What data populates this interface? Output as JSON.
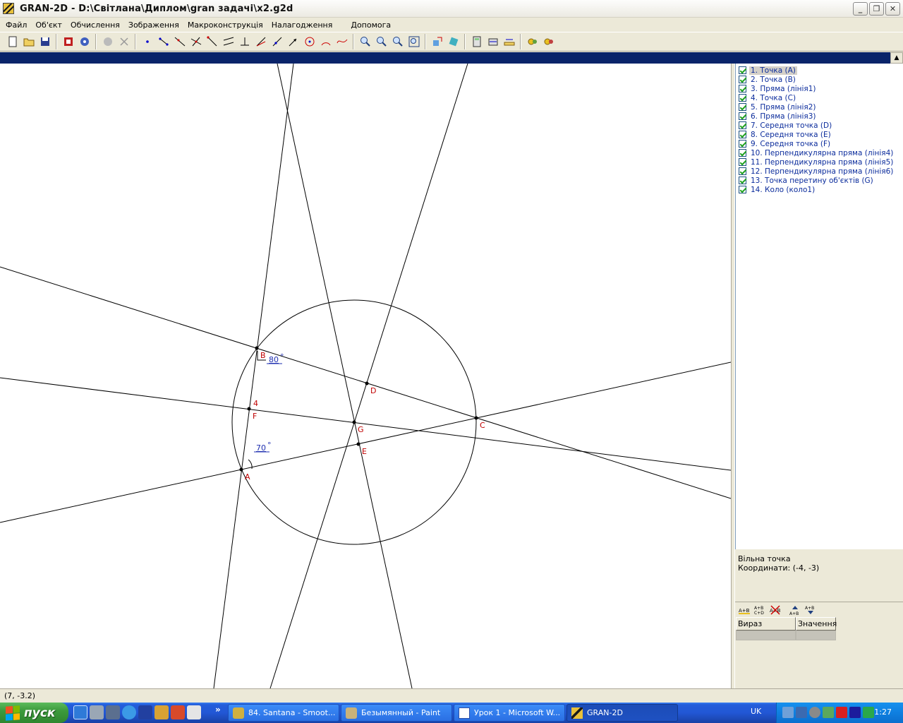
{
  "window": {
    "title": "GRAN-2D - D:\\Світлана\\Диплом\\gran задачі\\x2.g2d",
    "minimize_label": "_",
    "maximize_label": "❐",
    "close_label": "✕"
  },
  "menu": {
    "items": [
      "Файл",
      "Об'єкт",
      "Обчислення",
      "Зображення",
      "Макроконструкція",
      "Налагодження",
      "Допомога"
    ]
  },
  "toolbar": {
    "buttons": [
      "new-file-icon",
      "open-folder-icon",
      "save-disk-icon",
      "sep",
      "film-icon",
      "settings-icon",
      "sep",
      "disabled-icon",
      "cut-icon",
      "sep",
      "point-icon",
      "segment-icon",
      "line-icon",
      "intersect-icon",
      "ray-icon",
      "parallel-icon",
      "perpendicular-icon",
      "bisector-icon",
      "tangent-icon",
      "vector-icon",
      "circle-icon",
      "arc-icon",
      "curve-icon",
      "sep",
      "zoom-in-icon",
      "zoom-out-icon",
      "zoom-fit-icon",
      "zoom-window-icon",
      "sep",
      "move-icon",
      "rotate-icon",
      "sep",
      "calculator-icon",
      "measure-icon",
      "ruler-icon",
      "sep",
      "macro-icon",
      "macro-run-icon"
    ]
  },
  "canvas": {
    "labels": {
      "A": "A",
      "B": "B",
      "C": "C",
      "D": "D",
      "E": "E",
      "F": "F",
      "G": "G",
      "side_label": "4",
      "angle_B": "80",
      "angle_A": "70",
      "degree": "°"
    }
  },
  "objects": [
    {
      "label": "1. Точка (A)",
      "selected": true
    },
    {
      "label": "2. Точка (B)"
    },
    {
      "label": "3. Пряма (лінія1)"
    },
    {
      "label": "4. Точка (C)"
    },
    {
      "label": "5. Пряма (лінія2)"
    },
    {
      "label": "6. Пряма (лінія3)"
    },
    {
      "label": "7. Середня точка (D)"
    },
    {
      "label": "8. Середня точка (E)"
    },
    {
      "label": "9. Середня точка (F)"
    },
    {
      "label": "10. Перпендикулярна пряма (лінія4)"
    },
    {
      "label": "11. Перпендикулярна пряма (лінія5)"
    },
    {
      "label": "12. Перпендикулярна пряма (лінія6)"
    },
    {
      "label": "13. Точка перетину об'єктів (G)"
    },
    {
      "label": "14. Коло (коло1)"
    }
  ],
  "info": {
    "type": "Вільна точка",
    "coords": "Координати: (-4, -3)"
  },
  "calc": {
    "col_expression": "Вираз",
    "col_value": "Значення",
    "buttons": [
      "expr-add-icon",
      "expr-table-icon",
      "expr-delete-icon",
      "move-up-icon",
      "move-down-icon"
    ]
  },
  "status": {
    "cursor": "(7, -3.2)"
  },
  "taskbar": {
    "start_label": "пуск",
    "tasks": [
      {
        "label": "84. Santana - Smoot...",
        "icon": "winamp-icon"
      },
      {
        "label": "Безымянный - Paint",
        "icon": "paint-icon"
      },
      {
        "label": "Урок 1 - Microsoft W...",
        "icon": "word-icon"
      },
      {
        "label": "GRAN-2D",
        "icon": "gran-icon",
        "active": true
      }
    ],
    "language": "UK",
    "clock": "1:27"
  }
}
